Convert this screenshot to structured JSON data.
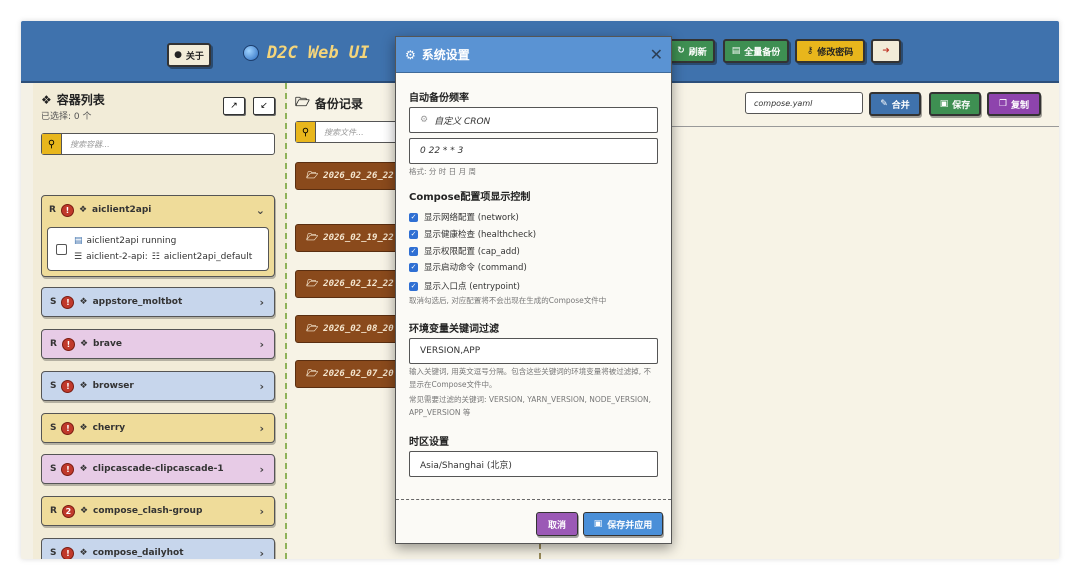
{
  "header": {
    "about_label": "关于",
    "app_title": "D2C Web UI",
    "refresh_label": "刷新",
    "full_backup_label": "全量备份",
    "change_password_label": "修改密码"
  },
  "containers": {
    "title": "容器列表",
    "selected": "已选择: 0 个",
    "search_placeholder": "搜索容器...",
    "items": [
      {
        "tag": "R",
        "badge": "!",
        "name": "aiclient2api",
        "color": "#efdc9a"
      },
      {
        "tag": "S",
        "badge": "!",
        "name": "appstore_moltbot",
        "color": "#c7d6ec"
      },
      {
        "tag": "R",
        "badge": "!",
        "name": "brave",
        "color": "#e7cbe6"
      },
      {
        "tag": "S",
        "badge": "!",
        "name": "browser",
        "color": "#c7d6ec"
      },
      {
        "tag": "S",
        "badge": "!",
        "name": "cherry",
        "color": "#efdc9a"
      },
      {
        "tag": "S",
        "badge": "!",
        "name": "clipcascade-clipcascade-1",
        "color": "#e7cbe6"
      },
      {
        "tag": "R",
        "badge": "2",
        "name": "compose_clash-group",
        "color": "#efdc9a"
      },
      {
        "tag": "S",
        "badge": "!",
        "name": "compose_dailyhot",
        "color": "#c7d6ec"
      }
    ],
    "expanded": {
      "line1": "aiclient2api running",
      "line2_prefix": "aiclient-2-api:",
      "line2_network": "aiclient2api_default"
    }
  },
  "backups": {
    "title": "备份记录",
    "search_placeholder": "搜索文件...",
    "items": [
      "2026_02_26_22",
      "2026_02_19_22",
      "2026_02_12_22",
      "2026_02_08_20",
      "2026_02_07_20"
    ]
  },
  "editor": {
    "filename": "compose.yaml",
    "merge_label": "合并",
    "save_label": "保存",
    "copy_label": "复制"
  },
  "modal": {
    "title": "系统设置",
    "backup_freq_label": "自动备份频率",
    "cron_mode": "自定义 CRON",
    "cron_value": "0 22 * * 3",
    "cron_hint": "格式: 分 时 日 月 周",
    "compose_label": "Compose配置项显示控制",
    "checks": [
      "显示网络配置 (network)",
      "显示健康检查 (healthcheck)",
      "显示权限配置 (cap_add)",
      "显示启动命令 (command)",
      "显示入口点 (entrypoint)"
    ],
    "compose_hint": "取消勾选后, 对应配置将不会出现在生成的Compose文件中",
    "env_label": "环境变量关键词过滤",
    "env_value": "VERSION,APP",
    "env_hint1": "输入关键词, 用英文逗号分隔。包含这些关键词的环境变量将被过滤掉, 不显示在Compose文件中。",
    "env_hint2": "常见需要过滤的关键词: VERSION, YARN_VERSION, NODE_VERSION, APP_VERSION 等",
    "tz_label": "时区设置",
    "tz_value": "Asia/Shanghai (北京)",
    "cancel_label": "取消",
    "apply_label": "保存并应用"
  },
  "colors": {
    "header": "#3f72ad",
    "accent_yellow": "#e8b61c",
    "backup_brown": "#8a4a1c",
    "modal_head": "#5a93d3"
  }
}
